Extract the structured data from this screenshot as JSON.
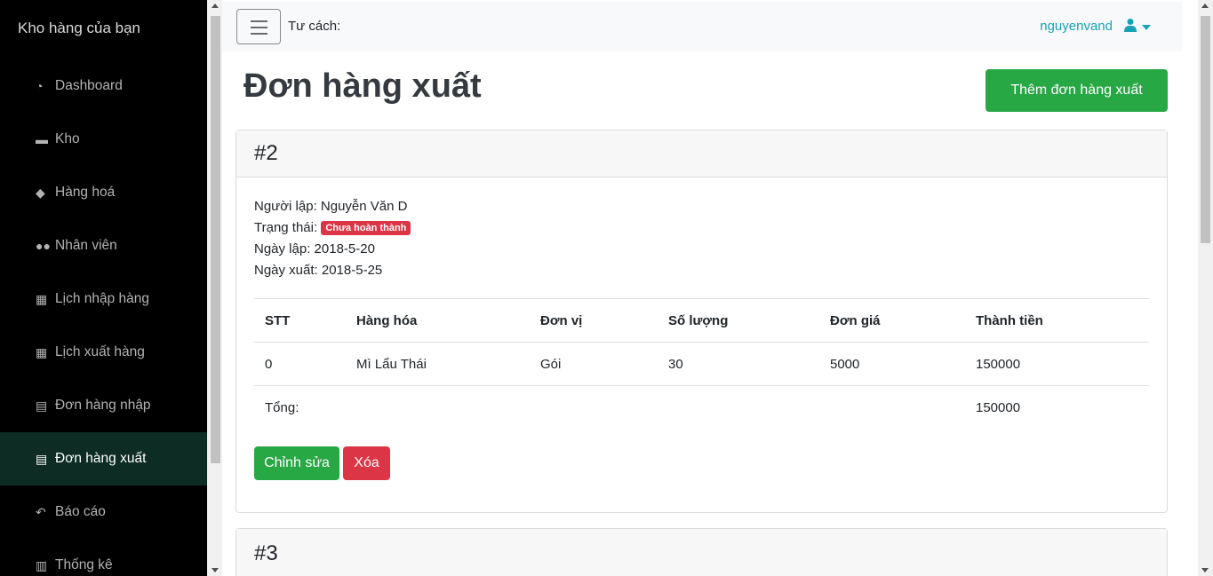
{
  "sidebar": {
    "brand": "Kho hàng của bạn",
    "items": [
      {
        "label": "Dashboard",
        "icon": "dashboard-icon"
      },
      {
        "label": "Kho",
        "icon": "warehouse-icon"
      },
      {
        "label": "Hàng hoá",
        "icon": "cube-icon"
      },
      {
        "label": "Nhân viên",
        "icon": "users-icon"
      },
      {
        "label": "Lịch nhập hàng",
        "icon": "calendar-icon"
      },
      {
        "label": "Lịch xuất hàng",
        "icon": "calendar-icon"
      },
      {
        "label": "Đơn hàng nhập",
        "icon": "file-icon"
      },
      {
        "label": "Đơn hàng xuất",
        "icon": "file-icon",
        "active": true
      },
      {
        "label": "Báo cáo",
        "icon": "reply-icon"
      },
      {
        "label": "Thống kê",
        "icon": "bar-chart-icon"
      }
    ]
  },
  "navbar": {
    "role_label": "Tư cách:",
    "username": "nguyenvand"
  },
  "page": {
    "title": "Đơn hàng xuất",
    "add_button": "Thêm đơn hàng xuất"
  },
  "orders": [
    {
      "id": "#2",
      "creator": "Người lập: Nguyễn Văn D",
      "status_label": "Trạng thái:",
      "status": "Chưa hoàn thành",
      "created_date": "Ngày lập: 2018-5-20",
      "export_date": "Ngày xuất: 2018-5-25",
      "columns": [
        "STT",
        "Hàng hóa",
        "Đơn vị",
        "Số lượng",
        "Đơn giá",
        "Thành tiền"
      ],
      "rows": [
        [
          "0",
          "Mì Lẩu Thái",
          "Gói",
          "30",
          "5000",
          "150000"
        ]
      ],
      "total_label": "Tổng:",
      "total": "150000",
      "edit_button": "Chỉnh sửa",
      "delete_button": "Xóa"
    },
    {
      "id": "#3"
    }
  ],
  "colors": {
    "sidebar_bg": "#000000",
    "sidebar_active": "#0c2c24",
    "success": "#28a745",
    "danger": "#dc3545",
    "info": "#17a2b8"
  }
}
